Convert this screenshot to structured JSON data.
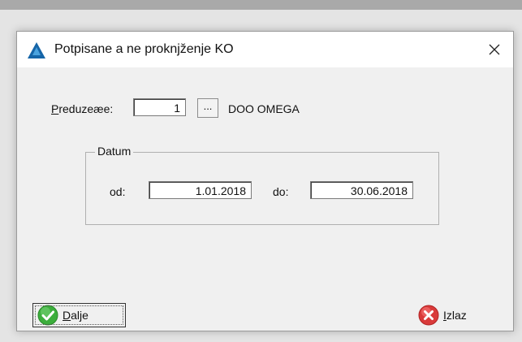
{
  "window": {
    "title": "Potpisane a ne proknjženje KO",
    "close_glyph": "✕"
  },
  "company": {
    "label_accel": "P",
    "label_rest": "reduzeæe:",
    "value": "1",
    "browse_label": "...",
    "name": "DOO OMEGA"
  },
  "date_group": {
    "title": "Datum",
    "from_label": "od:",
    "from_value": "1.01.2018",
    "to_label": "do:",
    "to_value": "30.06.2018"
  },
  "buttons": {
    "next_accel": "D",
    "next_rest": "alje",
    "next_icon": "check-circle-icon",
    "exit_accel": "I",
    "exit_rest": "zlaz",
    "exit_icon": "x-circle-icon"
  },
  "colors": {
    "app_icon": "#1565a8",
    "ok_green": "#3cae3c",
    "exit_red": "#d93a3a"
  }
}
